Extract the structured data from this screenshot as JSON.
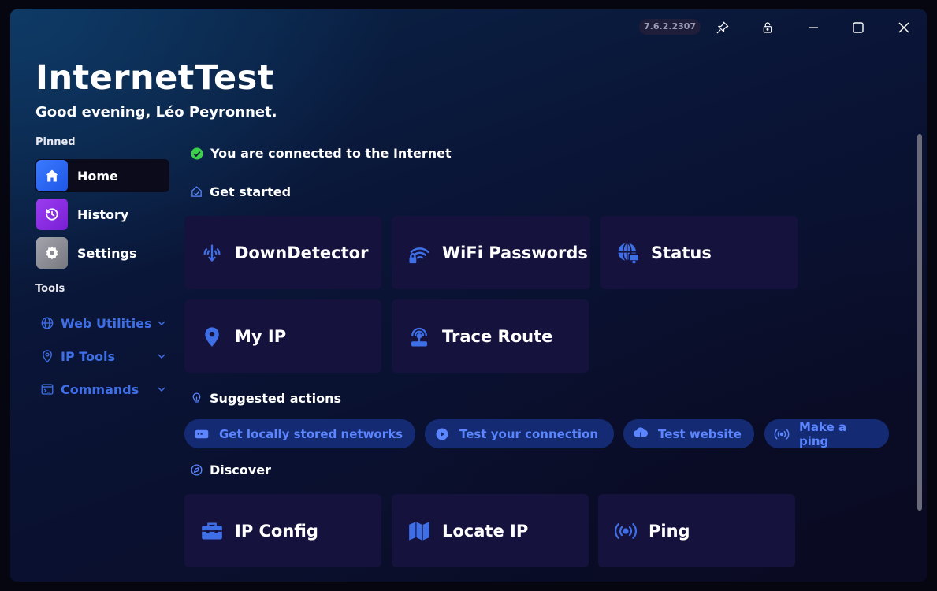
{
  "window": {
    "version": "7.6.2.2307",
    "app_title": "InternetTest",
    "greeting": "Good evening, Léo Peyronnet.",
    "controls": [
      "pin-icon",
      "lock-icon",
      "minimize-icon",
      "maximize-icon",
      "close-icon"
    ]
  },
  "sidebar": {
    "pinned_label": "Pinned",
    "pinned": [
      {
        "label": "Home",
        "icon": "home-icon",
        "color": "#2f6bff",
        "active": true
      },
      {
        "label": "History",
        "icon": "history-icon",
        "color": "#8a2be2",
        "active": false
      },
      {
        "label": "Settings",
        "icon": "gear-icon",
        "color": "#8c8c96",
        "active": false
      }
    ],
    "tools_label": "Tools",
    "tools": [
      {
        "label": "Web Utilities",
        "icon": "globe-icon"
      },
      {
        "label": "IP Tools",
        "icon": "location-pin-icon"
      },
      {
        "label": "Commands",
        "icon": "terminal-icon"
      }
    ]
  },
  "main": {
    "status": {
      "text": "You are connected to the Internet",
      "color": "#3dd04a"
    },
    "get_started": {
      "label": "Get started",
      "cards": [
        {
          "label": "DownDetector",
          "icon": "signal-down-icon"
        },
        {
          "label": "WiFi Passwords",
          "icon": "wifi-lock-icon"
        },
        {
          "label": "Status",
          "icon": "globe-monitor-icon"
        },
        {
          "label": "My IP",
          "icon": "location-pin-icon"
        },
        {
          "label": "Trace Route",
          "icon": "route-beacon-icon"
        }
      ]
    },
    "suggested": {
      "label": "Suggested actions",
      "chips": [
        {
          "label": "Get locally stored networks",
          "icon": "network-card-icon"
        },
        {
          "label": "Test your connection",
          "icon": "play-circle-icon"
        },
        {
          "label": "Test website",
          "icon": "cloud-download-icon"
        },
        {
          "label": "Make a ping",
          "icon": "broadcast-icon"
        }
      ]
    },
    "discover": {
      "label": "Discover",
      "cards": [
        {
          "label": "IP Config",
          "icon": "toolbox-icon"
        },
        {
          "label": "Locate IP",
          "icon": "map-icon"
        },
        {
          "label": "Ping",
          "icon": "broadcast-icon"
        }
      ]
    }
  },
  "colors": {
    "accent": "#3f6fe6",
    "card_bg": "#15133e",
    "chip_bg": "#142a72",
    "chip_text": "#5b86ff"
  }
}
